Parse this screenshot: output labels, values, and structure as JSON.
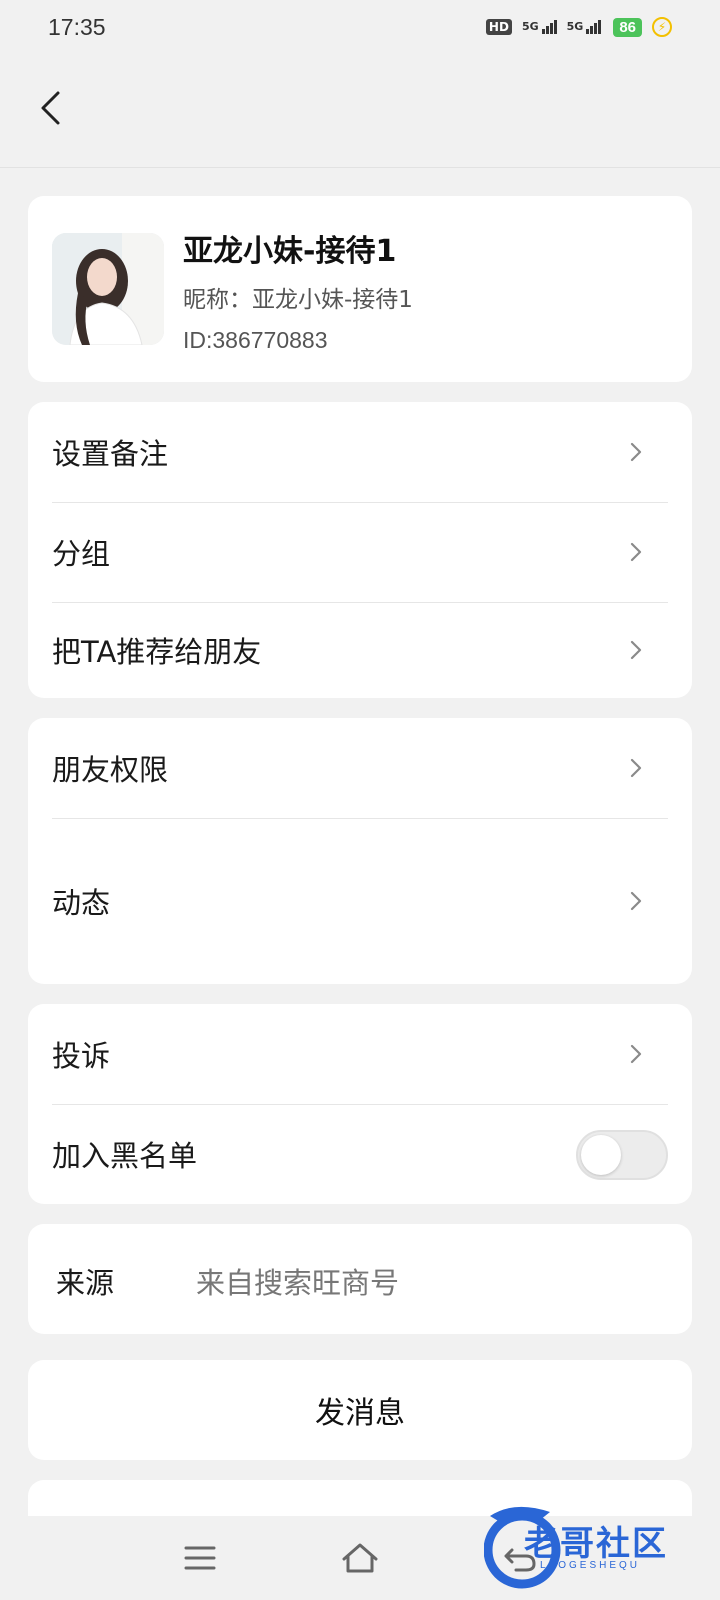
{
  "status_bar": {
    "time": "17:35",
    "hd_label": "HD",
    "net1": "5G",
    "net2": "5G",
    "battery": "86"
  },
  "profile": {
    "name": "亚龙小妹-接待1",
    "nickname": "昵称：亚龙小妹-接待1",
    "id": "ID:386770883"
  },
  "section1": {
    "items": [
      {
        "label": "设置备注"
      },
      {
        "label": "分组"
      },
      {
        "label": "把TA推荐给朋友"
      }
    ]
  },
  "section2": {
    "items": [
      {
        "label": "朋友权限"
      },
      {
        "label": "动态"
      }
    ]
  },
  "section3": {
    "complaint": "投诉",
    "blacklist": "加入黑名单",
    "blacklist_enabled": false
  },
  "source": {
    "label": "来源",
    "value": "来自搜索旺商号"
  },
  "send_message": "发消息",
  "watermark": {
    "text": "老哥社区",
    "sub": "LAOGESHEQU"
  },
  "colors": {
    "background": "#f1f1f1",
    "card": "#ffffff",
    "battery": "#4cc35a",
    "watermark": "#2a66d6"
  }
}
